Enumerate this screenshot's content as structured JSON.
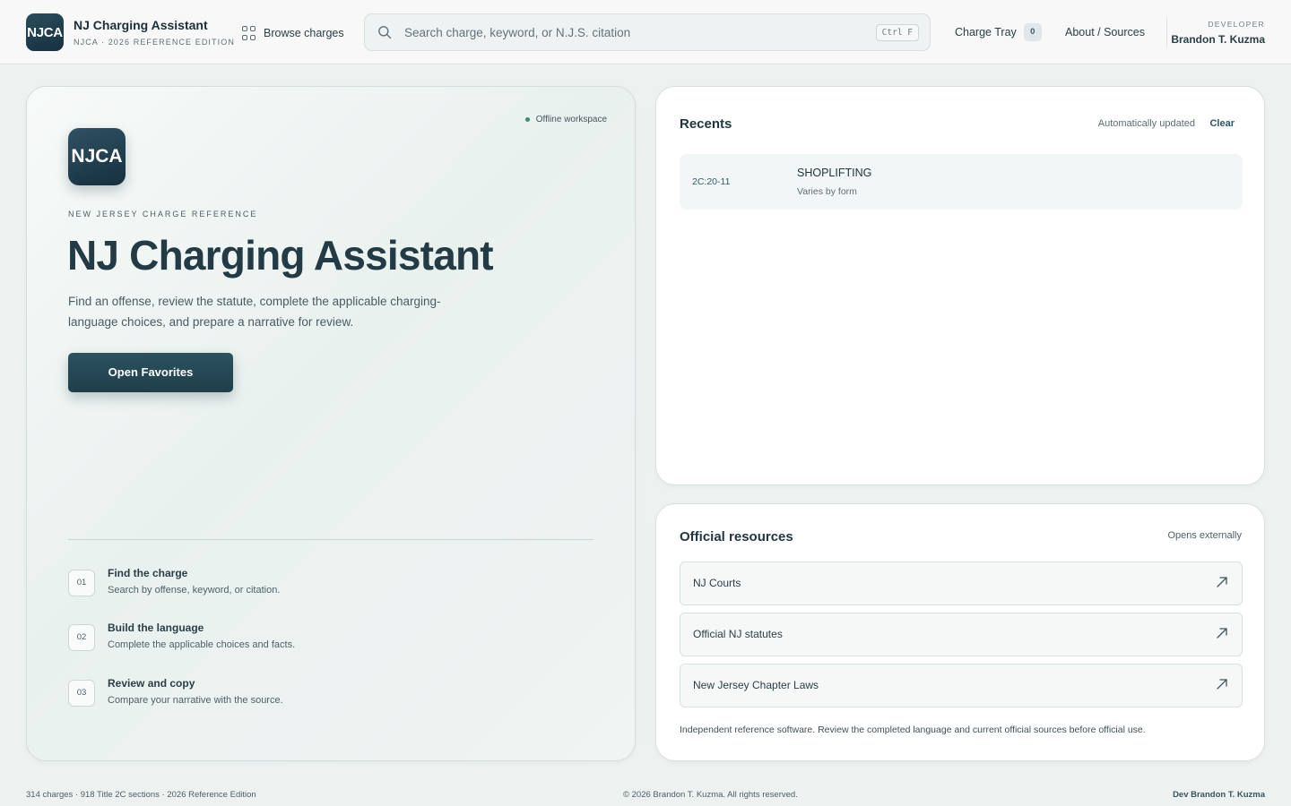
{
  "header": {
    "logo_text": "NJCA",
    "app_name": "NJ Charging Assistant",
    "edition": "NJCA · 2026 REFERENCE EDITION",
    "browse_label": "Browse charges",
    "search_placeholder": "Search charge, keyword, or N.J.S. citation",
    "search_value": "",
    "search_shortcut": "Ctrl F",
    "tray_label": "Charge Tray",
    "tray_count": "0",
    "about_label": "About / Sources",
    "developer_label": "DEVELOPER",
    "developer_name": "Brandon T. Kuzma"
  },
  "hero": {
    "status": "Offline workspace",
    "logo_text": "NJCA",
    "eyebrow": "NEW JERSEY CHARGE REFERENCE",
    "title": "NJ Charging Assistant",
    "description": "Find an offense, review the statute, complete the applicable charging-language choices, and prepare a narrative for review.",
    "cta_label": "Open Favorites",
    "steps": [
      {
        "num": "01",
        "title": "Find the charge",
        "desc": "Search by offense, keyword, or citation."
      },
      {
        "num": "02",
        "title": "Build the language",
        "desc": "Complete the applicable choices and facts."
      },
      {
        "num": "03",
        "title": "Review and copy",
        "desc": "Compare your narrative with the source."
      }
    ]
  },
  "recents": {
    "title": "Recents",
    "auto_label": "Automatically updated",
    "clear_label": "Clear",
    "items": [
      {
        "citation": "2C:20-11",
        "name": "SHOPLIFTING",
        "grade": "Varies by form"
      }
    ]
  },
  "resources": {
    "title": "Official resources",
    "note_right": "Opens externally",
    "links": [
      {
        "label": "NJ Courts"
      },
      {
        "label": "Official NJ statutes"
      },
      {
        "label": "New Jersey Chapter Laws"
      }
    ],
    "disclaimer": "Independent reference software. Review the completed language and current official sources before official use."
  },
  "footer": {
    "stats": "314 charges · 918 Title 2C sections · 2026 Reference Edition",
    "copyright": "© 2026 Brandon T. Kuzma. All rights reserved.",
    "credit": "Dev Brandon T. Kuzma"
  },
  "colors": {
    "accent": "#1f3e4a",
    "status_dot": "#3d8a79",
    "background": "#edf1f0"
  }
}
